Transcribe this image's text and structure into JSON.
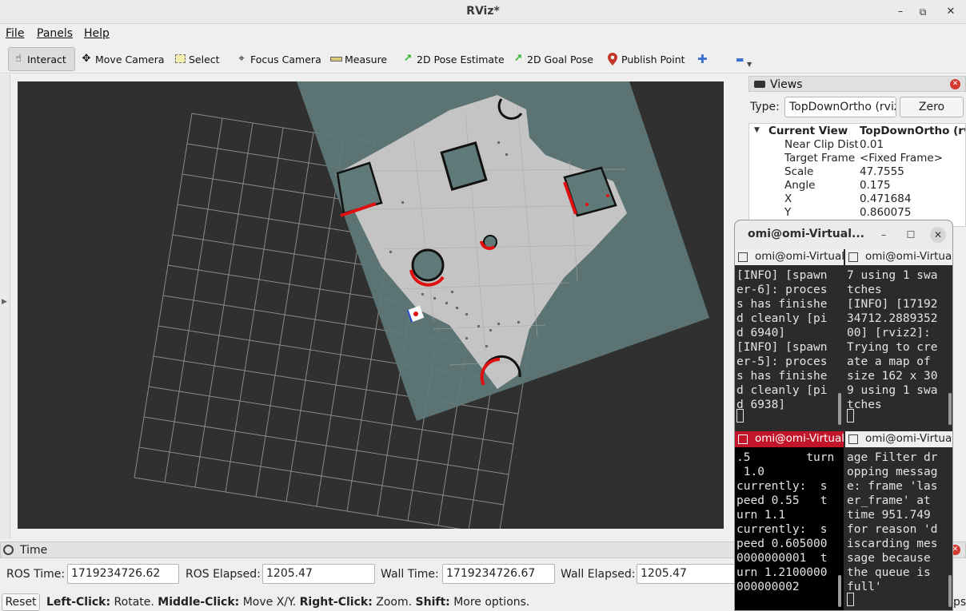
{
  "window": {
    "title": "RViz*",
    "minimize": "–",
    "maximize": "⧉",
    "close": "✕"
  },
  "menu": [
    "File",
    "Panels",
    "Help"
  ],
  "toolbar": {
    "interact": "Interact",
    "move_camera": "Move Camera",
    "select": "Select",
    "focus_camera": "Focus Camera",
    "measure": "Measure",
    "pose_estimate": "2D Pose Estimate",
    "goal_pose": "2D Goal Pose",
    "publish_point": "Publish Point",
    "add": "✚",
    "remove": "▬"
  },
  "views": {
    "title": "Views",
    "type_label": "Type:",
    "type_value": "TopDownOrtho (rviz_default_plugins)",
    "zero_label": "Zero",
    "properties": [
      {
        "key": "Current View",
        "value": "TopDownOrtho (rviz_default_plugins)"
      },
      {
        "key": "Near Clip Distance",
        "value": "0.01"
      },
      {
        "key": "Target Frame",
        "value": "<Fixed Frame>"
      },
      {
        "key": "Scale",
        "value": "47.7555"
      },
      {
        "key": "Angle",
        "value": "0.175"
      },
      {
        "key": "X",
        "value": "0.471684"
      },
      {
        "key": "Y",
        "value": "0.860075"
      }
    ]
  },
  "time": {
    "title": "Time",
    "ros_time_label": "ROS Time:",
    "ros_time": "1719234726.62",
    "ros_elapsed_label": "ROS Elapsed:",
    "ros_elapsed": "1205.47",
    "wall_time_label": "Wall Time:",
    "wall_time": "1719234726.67",
    "wall_elapsed_label": "Wall Elapsed:",
    "wall_elapsed": "1205.47"
  },
  "status": {
    "reset": "Reset",
    "left_click": "Left-Click:",
    "left_action": "Rotate.",
    "middle_click": "Middle-Click:",
    "middle_action": "Move X/Y.",
    "right_click": "Right-Click:",
    "right_action": "Zoom.",
    "shift": "Shift:",
    "shift_action": "More options.",
    "trailing": "ps"
  },
  "terminal": {
    "title": "omi@omi-Virtual...",
    "panes": [
      {
        "tab": "omi@omi-VirtualBox: ~",
        "text": "[INFO] [spawn\ner-6]: proces\ns has finishe\nd cleanly [pi\nd 6940]\n[INFO] [spawn\ner-5]: proces\ns has finishe\nd cleanly [pi\nd 6938]"
      },
      {
        "tab": "omi@omi-VirtualBox: ~",
        "text": "7 using 1 swa\ntches\n[INFO] [17192\n34712.2889352\n00] [rviz2]:\nTrying to cre\nate a map of\nsize 162 x 30\n9 using 1 swa\ntches"
      },
      {
        "tab": "omi@omi-VirtualBox: ~",
        "text": ".5        turn\n 1.0\ncurrently:  s\npeed 0.55   t\nurn 1.1\ncurrently:  s\npeed 0.605000\n0000000001  t\nurn 1.2100000\n000000002"
      },
      {
        "tab": "omi@omi-VirtualBox: ~",
        "text": "age Filter dr\nopping messag\ne: frame 'las\ner_frame' at\ntime 951.749\nfor reason 'd\niscarding mes\nsage because\nthe queue is\nfull'"
      }
    ]
  },
  "colors": {
    "accent_red": "#c2152a",
    "laser": "#e01010",
    "map_free": "#c4c4c4",
    "costmap": "#5f7a78",
    "background": "#303030"
  }
}
